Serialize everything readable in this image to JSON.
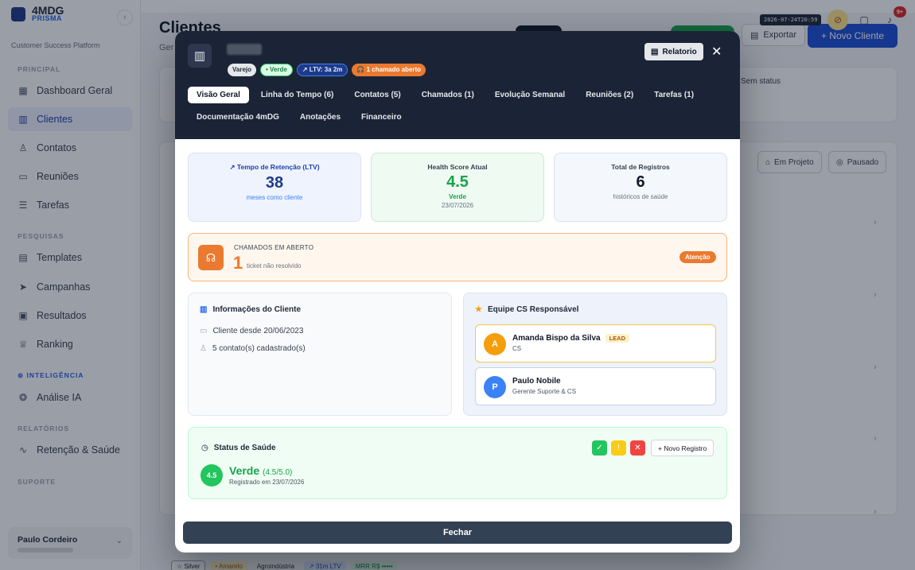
{
  "sidebar": {
    "brand_name": "4MDG",
    "brand_sub": "PRISMA",
    "collapse_icon": "chevron-left-icon",
    "platform": "Customer Success Platform",
    "sections": {
      "principal": "PRINCIPAL",
      "pesquisas": "PESQUISAS",
      "inteligencia": "INTELIGÊNCIA",
      "relatorios": "RELATÓRIOS",
      "suporte": "SUPORTE"
    },
    "items": {
      "dashboard": "Dashboard Geral",
      "clientes": "Clientes",
      "contatos": "Contatos",
      "reunioes": "Reuniões",
      "tarefas": "Tarefas",
      "templates": "Templates",
      "campanhas": "Campanhas",
      "resultados": "Resultados",
      "ranking": "Ranking",
      "analise": "Análise IA",
      "retencao": "Retenção & Saúde"
    },
    "user_name": "Paulo Cordeiro"
  },
  "page": {
    "title": "Clientes",
    "subtitle": "Ger",
    "timestamp": "2026-07-24T20:59",
    "notif_count": "9+",
    "export_label": "Exportar",
    "new_client_label": "+ Novo Cliente",
    "sem_status": "Sem status",
    "filter_projeto": "Em Projeto",
    "filter_pausado": "Pausado",
    "bottom": {
      "tier": "☆ Silver",
      "health": "• Amarelo",
      "segment": "Agroindústria",
      "ltv": "↗ 31m LTV",
      "mrr": "MRR R$ •••••"
    }
  },
  "modal": {
    "badges": {
      "segment": "Varejo",
      "health": "• Verde",
      "ltv": "↗ LTV: 3a 2m",
      "tickets": "🎧 1 chamado aberto"
    },
    "report_label": "Relatorio",
    "tabs_row1": [
      "Visão Geral",
      "Linha do Tempo (6)",
      "Contatos (5)",
      "Chamados (1)",
      "Evolução Semanal",
      "Reuniões (2)",
      "Tarefas (1)"
    ],
    "tabs_row2": [
      "Documentação 4mDG",
      "Anotações",
      "Financeiro"
    ],
    "stats": {
      "ltv": {
        "label": "↗ Tempo de Retenção (LTV)",
        "value": "38",
        "sub": "meses como cliente"
      },
      "health": {
        "label": "Health Score Atual",
        "value": "4.5",
        "status": "Verde",
        "date": "23/07/2026"
      },
      "records": {
        "label": "Total de Registros",
        "value": "6",
        "sub": "históricos de saúde"
      }
    },
    "alert": {
      "title": "CHAMADOS EM ABERTO",
      "count": "1",
      "sub": "ticket não resolvido",
      "badge": "Atenção"
    },
    "info": {
      "title": "Informações do Cliente",
      "since": "Cliente desde 20/06/2023",
      "contacts": "5 contato(s) cadastrado(s)"
    },
    "team": {
      "title": "Equipe CS Responsável",
      "members": [
        {
          "initial": "A",
          "name": "Amanda Bispo da Silva",
          "tag": "LEAD",
          "role": "CS",
          "color": "#f59e0b"
        },
        {
          "initial": "P",
          "name": "Paulo Nobile",
          "tag": "",
          "role": "Gerente Suporte & CS",
          "color": "#3b82f6"
        }
      ]
    },
    "health": {
      "title": "Status de Saúde",
      "new_record": "+ Novo Registro",
      "score": "4.5",
      "status": "Verde",
      "score_text": "(4.5/5.0)",
      "date": "Registrado em 23/07/2026"
    },
    "close_label": "Fechar"
  }
}
